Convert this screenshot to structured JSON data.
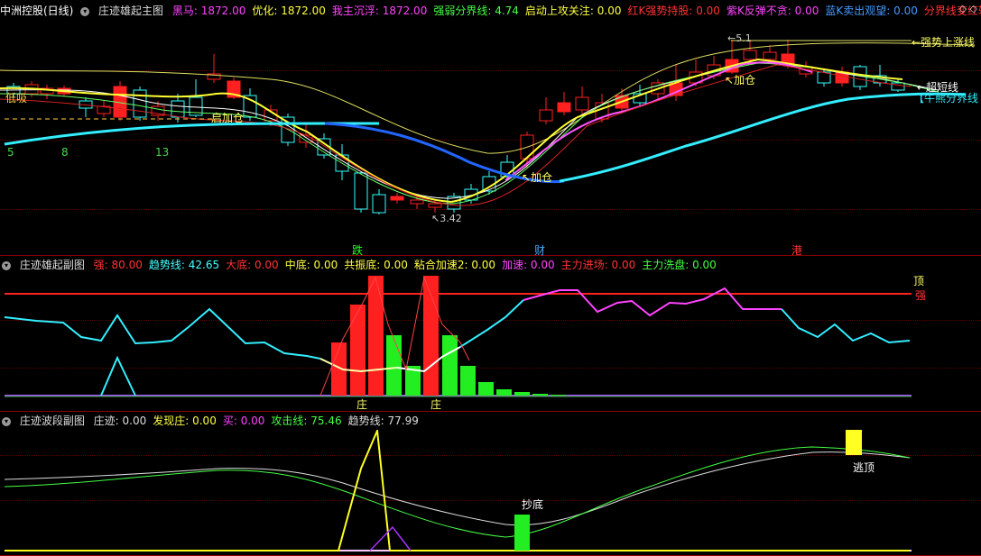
{
  "main": {
    "title": "中洲控股(日线)",
    "indicator": "庄迹雄起主图",
    "params": [
      {
        "label": "黑马: ",
        "value": "1872.00",
        "color": "#ff44ff"
      },
      {
        "label": "优化: ",
        "value": "1872.00",
        "color": "#ffff44"
      },
      {
        "label": "我主沉浮: ",
        "value": "1872.00",
        "color": "#ff44ff"
      },
      {
        "label": "强弱分界线: ",
        "value": "4.74",
        "color": "#44ff44"
      },
      {
        "label": "启动上攻关注: ",
        "value": "0.00",
        "color": "#ffff44"
      },
      {
        "label": "红K强势持股: ",
        "value": "0.00",
        "color": "#ff3333"
      },
      {
        "label": "紫K反弹不贪: ",
        "value": "0.00",
        "color": "#ff44ff"
      },
      {
        "label": "蓝K卖出观望: ",
        "value": "0.00",
        "color": "#4499ff"
      },
      {
        "label": "分界线变红转强",
        "value": "",
        "color": "#ff3333"
      }
    ],
    "window_controls": "◇ ◇",
    "annotations": {
      "strong_up": "←强势上涨线",
      "super_short": "←超短线",
      "bull_bear": "牛熊分界线",
      "price_low": "3.42",
      "price_high": "5.1",
      "add1": "加仓",
      "add2": "加仓",
      "start_add": "启加仓",
      "left_label": "低吸",
      "num5": "5",
      "num8": "8",
      "num13": "13",
      "bottom_tags": [
        {
          "text": "跌",
          "color": "#22ff22"
        },
        {
          "text": "财",
          "color": "#44aaff"
        },
        {
          "text": "港",
          "color": "#ff3333"
        }
      ]
    }
  },
  "sub1": {
    "indicator": "庄迹雄起副图",
    "params": [
      {
        "label": "强: ",
        "value": "80.00",
        "color": "#ff3333"
      },
      {
        "label": "趋势线: ",
        "value": "42.65",
        "color": "#44ffff"
      },
      {
        "label": "大底: ",
        "value": "0.00",
        "color": "#ff3333"
      },
      {
        "label": "中底: ",
        "value": "0.00",
        "color": "#ffff44"
      },
      {
        "label": "共振底: ",
        "value": "0.00",
        "color": "#ffff44"
      },
      {
        "label": "粘合加速2: ",
        "value": "0.00",
        "color": "#ffff44"
      },
      {
        "label": "加速: ",
        "value": "0.00",
        "color": "#ff44ff"
      },
      {
        "label": "主力进场: ",
        "value": "0.00",
        "color": "#ff3333"
      },
      {
        "label": "主力洗盘: ",
        "value": "0.00",
        "color": "#44ff44"
      }
    ],
    "top_label": "顶",
    "strong_label": "强",
    "zhuang_labels": [
      "庄",
      "庄"
    ]
  },
  "sub2": {
    "indicator": "庄迹波段副图",
    "params": [
      {
        "label": "庄迹: ",
        "value": "0.00",
        "color": "#dddddd"
      },
      {
        "label": "发现庄: ",
        "value": "0.00",
        "color": "#ffff44"
      },
      {
        "label": "买: ",
        "value": "0.00",
        "color": "#ff44ff"
      },
      {
        "label": "攻击线: ",
        "value": "75.46",
        "color": "#44ff44"
      },
      {
        "label": "趋势线: ",
        "value": "77.99",
        "color": "#dddddd"
      }
    ],
    "buy_bottom": "抄底",
    "escape_top": "逃顶"
  },
  "colors": {
    "background": "#000000",
    "separator": "#8b0000",
    "up": "#ff2020",
    "down": "#33ffff",
    "bull_bear_line": "#33eeff"
  }
}
